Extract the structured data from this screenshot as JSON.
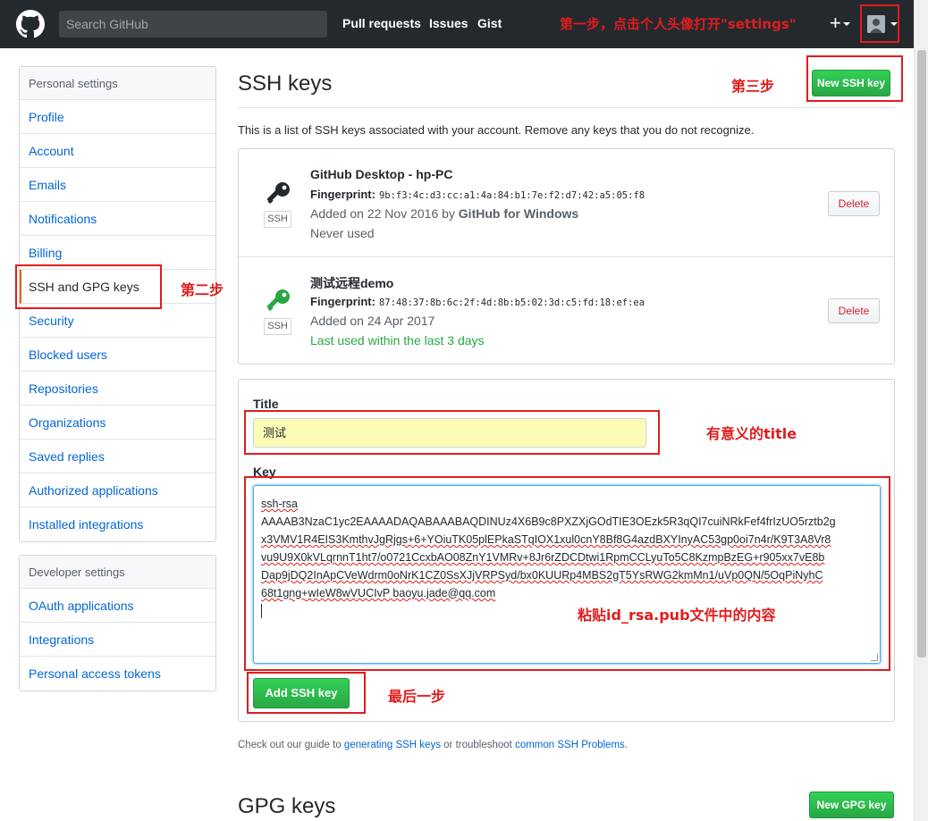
{
  "header": {
    "search_placeholder": "Search GitHub",
    "nav": [
      "Pull requests",
      "Issues",
      "Gist"
    ],
    "plus_label": "+"
  },
  "sidebar": {
    "personal_heading": "Personal settings",
    "personal_items": [
      "Profile",
      "Account",
      "Emails",
      "Notifications",
      "Billing",
      "SSH and GPG keys",
      "Security",
      "Blocked users",
      "Repositories",
      "Organizations",
      "Saved replies",
      "Authorized applications",
      "Installed integrations"
    ],
    "selected_index": 5,
    "developer_heading": "Developer settings",
    "developer_items": [
      "OAuth applications",
      "Integrations",
      "Personal access tokens"
    ]
  },
  "main": {
    "ssh_heading": "SSH keys",
    "new_ssh_key_label": "New SSH key",
    "intro": "This is a list of SSH keys associated with your account. Remove any keys that you do not recognize.",
    "badge_label": "SSH",
    "fingerprint_label": "Fingerprint:",
    "delete_label": "Delete",
    "keys": [
      {
        "title": "GitHub Desktop - hp-PC",
        "fingerprint": "9b:f3:4c:d3:cc:a1:4a:84:b1:7e:f2:d7:42:a5:05:f8",
        "added_prefix": "Added on 22 Nov 2016 by ",
        "added_by": "GitHub for Windows",
        "usage": "Never used",
        "icon_color": "#24292e",
        "usage_color": "#586069"
      },
      {
        "title": "测试远程demo",
        "fingerprint": "87:48:37:8b:6c:2f:4d:8b:b5:02:3d:c5:fd:18:ef:ea",
        "added_prefix": "Added on 24 Apr 2017",
        "added_by": "",
        "usage": "Last used within the last 3 days",
        "icon_color": "#28a745",
        "usage_color": "#28a745"
      }
    ],
    "form": {
      "title_label": "Title",
      "title_value": "测试",
      "key_label": "Key",
      "key_lines": [
        "ssh-rsa",
        "AAAAB3NzaC1yc2EAAAADAQABAAABAQDINUz4X6B9c8PXZXjGOdTIE3OEzk5R3qQI7cuiNRkFef4frIzUO5rztb2g",
        "x3VMV1R4EIS3KmthvJgRjgs+6+YOiuTK05plEPkaSTqIOX1xul0cnY8Bf8G4azdBXYInyAC53gp0oi7n4r/K9T3A8Vr8",
        "vu9U9X0kVLqrnnT1ht7/o0721CcxbAO08ZnY1VMRv+8Jr6rZDCDtwi1RpmCCLyuTo5C8KzmpBzEG+r905xx7vE8b",
        "Dap9jDQ2InApCVeWdrm0oNrK1CZ0SsXJjVRPSyd/bx0KUURp4MBS2gT5YsRWG2kmMn1/uVp0QN/5OqPiNyhC",
        "68t1gng+wIeW8wVUCIvP baoyu.jade@qq.com"
      ],
      "add_label": "Add SSH key"
    },
    "footer": {
      "prefix": "Check out our guide to ",
      "link1": "generating SSH keys",
      "middle": " or troubleshoot ",
      "link2": "common SSH Problems",
      "suffix": "."
    },
    "gpg_heading": "GPG keys",
    "new_gpg_key_label": "New GPG key"
  },
  "annotations": {
    "step1": "第一步，点击个人头像打开\"settings\"",
    "step2": "第二步",
    "step3": "第三步",
    "title_note": "有意义的title",
    "paste_note": "粘贴id_rsa.pub文件中的内容",
    "last_step": "最后一步"
  }
}
